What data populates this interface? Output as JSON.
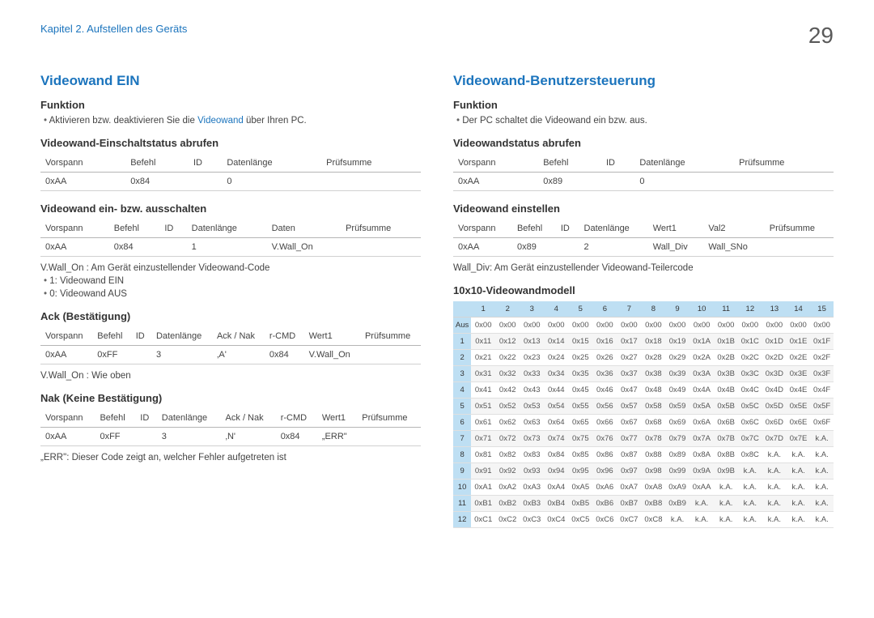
{
  "header": {
    "chapter": "Kapitel 2. Aufstellen des Geräts",
    "page": "29"
  },
  "left": {
    "title": "Videowand EIN",
    "funk_h": "Funktion",
    "funk_b1a": "Aktivieren bzw. deaktivieren Sie die ",
    "funk_b1b": "Videowand",
    "funk_b1c": " über Ihren PC.",
    "t1_h": "Videowand-Einschaltstatus abrufen",
    "t1": {
      "h": [
        "Vorspann",
        "Befehl",
        "ID",
        "Datenlänge",
        "Prüfsumme"
      ],
      "r": [
        "0xAA",
        "0x84",
        "",
        "0",
        ""
      ]
    },
    "t2_h": "Videowand ein- bzw. ausschalten",
    "t2": {
      "h": [
        "Vorspann",
        "Befehl",
        "ID",
        "Datenlänge",
        "Daten",
        "Prüfsumme"
      ],
      "r": [
        "0xAA",
        "0x84",
        "",
        "1",
        "V.Wall_On",
        ""
      ]
    },
    "n1": "V.Wall_On : Am Gerät einzustellender Videowand-Code",
    "n1a": "1: Videowand EIN",
    "n1b": "0: Videowand AUS",
    "t3_h": "Ack (Bestätigung)",
    "t3": {
      "h": [
        "Vorspann",
        "Befehl",
        "ID",
        "Datenlänge",
        "Ack / Nak",
        "r-CMD",
        "Wert1",
        "Prüfsumme"
      ],
      "r": [
        "0xAA",
        "0xFF",
        "",
        "3",
        "‚A'",
        "0x84",
        "V.Wall_On",
        ""
      ]
    },
    "n2": "V.Wall_On : Wie oben",
    "t4_h": "Nak (Keine Bestätigung)",
    "t4": {
      "h": [
        "Vorspann",
        "Befehl",
        "ID",
        "Datenlänge",
        "Ack / Nak",
        "r-CMD",
        "Wert1",
        "Prüfsumme"
      ],
      "r": [
        "0xAA",
        "0xFF",
        "",
        "3",
        "‚N'",
        "0x84",
        "„ERR\"",
        ""
      ]
    },
    "n3": "„ERR\": Dieser Code zeigt an, welcher Fehler aufgetreten ist"
  },
  "right": {
    "title": "Videowand-Benutzersteuerung",
    "funk_h": "Funktion",
    "funk_b": "Der PC schaltet die Videowand ein bzw. aus.",
    "t1_h": "Videowandstatus abrufen",
    "t1": {
      "h": [
        "Vorspann",
        "Befehl",
        "ID",
        "Datenlänge",
        "Prüfsumme"
      ],
      "r": [
        "0xAA",
        "0x89",
        "",
        "0",
        ""
      ]
    },
    "t2_h": "Videowand einstellen",
    "t2": {
      "h": [
        "Vorspann",
        "Befehl",
        "ID",
        "Datenlänge",
        "Wert1",
        "Val2",
        "Prüfsumme"
      ],
      "r": [
        "0xAA",
        "0x89",
        "",
        "2",
        "Wall_Div",
        "Wall_SNo",
        ""
      ]
    },
    "n1": "Wall_Div: Am Gerät einzustellender Videowand-Teilercode",
    "model_h": "10x10-Videowandmodell",
    "model": {
      "header": [
        "",
        "1",
        "2",
        "3",
        "4",
        "5",
        "6",
        "7",
        "8",
        "9",
        "10",
        "11",
        "12",
        "13",
        "14",
        "15"
      ],
      "rows": [
        [
          "Aus",
          "0x00",
          "0x00",
          "0x00",
          "0x00",
          "0x00",
          "0x00",
          "0x00",
          "0x00",
          "0x00",
          "0x00",
          "0x00",
          "0x00",
          "0x00",
          "0x00",
          "0x00"
        ],
        [
          "1",
          "0x11",
          "0x12",
          "0x13",
          "0x14",
          "0x15",
          "0x16",
          "0x17",
          "0x18",
          "0x19",
          "0x1A",
          "0x1B",
          "0x1C",
          "0x1D",
          "0x1E",
          "0x1F"
        ],
        [
          "2",
          "0x21",
          "0x22",
          "0x23",
          "0x24",
          "0x25",
          "0x26",
          "0x27",
          "0x28",
          "0x29",
          "0x2A",
          "0x2B",
          "0x2C",
          "0x2D",
          "0x2E",
          "0x2F"
        ],
        [
          "3",
          "0x31",
          "0x32",
          "0x33",
          "0x34",
          "0x35",
          "0x36",
          "0x37",
          "0x38",
          "0x39",
          "0x3A",
          "0x3B",
          "0x3C",
          "0x3D",
          "0x3E",
          "0x3F"
        ],
        [
          "4",
          "0x41",
          "0x42",
          "0x43",
          "0x44",
          "0x45",
          "0x46",
          "0x47",
          "0x48",
          "0x49",
          "0x4A",
          "0x4B",
          "0x4C",
          "0x4D",
          "0x4E",
          "0x4F"
        ],
        [
          "5",
          "0x51",
          "0x52",
          "0x53",
          "0x54",
          "0x55",
          "0x56",
          "0x57",
          "0x58",
          "0x59",
          "0x5A",
          "0x5B",
          "0x5C",
          "0x5D",
          "0x5E",
          "0x5F"
        ],
        [
          "6",
          "0x61",
          "0x62",
          "0x63",
          "0x64",
          "0x65",
          "0x66",
          "0x67",
          "0x68",
          "0x69",
          "0x6A",
          "0x6B",
          "0x6C",
          "0x6D",
          "0x6E",
          "0x6F"
        ],
        [
          "7",
          "0x71",
          "0x72",
          "0x73",
          "0x74",
          "0x75",
          "0x76",
          "0x77",
          "0x78",
          "0x79",
          "0x7A",
          "0x7B",
          "0x7C",
          "0x7D",
          "0x7E",
          "k.A."
        ],
        [
          "8",
          "0x81",
          "0x82",
          "0x83",
          "0x84",
          "0x85",
          "0x86",
          "0x87",
          "0x88",
          "0x89",
          "0x8A",
          "0x8B",
          "0x8C",
          "k.A.",
          "k.A.",
          "k.A."
        ],
        [
          "9",
          "0x91",
          "0x92",
          "0x93",
          "0x94",
          "0x95",
          "0x96",
          "0x97",
          "0x98",
          "0x99",
          "0x9A",
          "0x9B",
          "k.A.",
          "k.A.",
          "k.A.",
          "k.A."
        ],
        [
          "10",
          "0xA1",
          "0xA2",
          "0xA3",
          "0xA4",
          "0xA5",
          "0xA6",
          "0xA7",
          "0xA8",
          "0xA9",
          "0xAA",
          "k.A.",
          "k.A.",
          "k.A.",
          "k.A.",
          "k.A."
        ],
        [
          "11",
          "0xB1",
          "0xB2",
          "0xB3",
          "0xB4",
          "0xB5",
          "0xB6",
          "0xB7",
          "0xB8",
          "0xB9",
          "k.A.",
          "k.A.",
          "k.A.",
          "k.A.",
          "k.A.",
          "k.A."
        ],
        [
          "12",
          "0xC1",
          "0xC2",
          "0xC3",
          "0xC4",
          "0xC5",
          "0xC6",
          "0xC7",
          "0xC8",
          "k.A.",
          "k.A.",
          "k.A.",
          "k.A.",
          "k.A.",
          "k.A.",
          "k.A."
        ]
      ]
    }
  }
}
